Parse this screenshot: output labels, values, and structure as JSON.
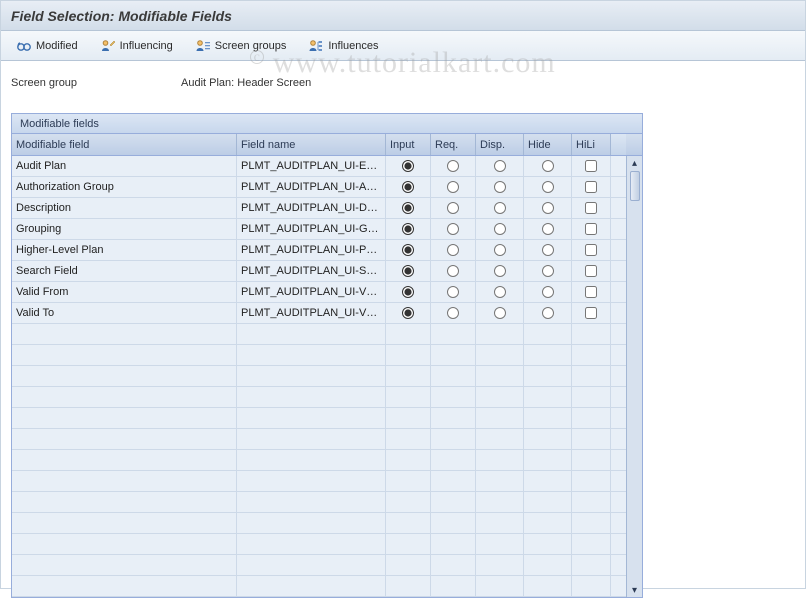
{
  "title": "Field Selection: Modifiable Fields",
  "toolbar": {
    "modified": "Modified",
    "influencing": "Influencing",
    "screen_groups": "Screen groups",
    "influences": "Influences"
  },
  "form": {
    "screen_group_label": "Screen group",
    "screen_group_value": "Audit Plan: Header Screen"
  },
  "table": {
    "title": "Modifiable fields",
    "columns": {
      "modifiable_field": "Modifiable field",
      "field_name": "Field name",
      "input": "Input",
      "req": "Req.",
      "disp": "Disp.",
      "hide": "Hide",
      "hili": "HiLi"
    },
    "rows": [
      {
        "label": "Audit Plan",
        "field": "PLMT_AUDITPLAN_UI-E…",
        "sel": "input"
      },
      {
        "label": "Authorization Group",
        "field": "PLMT_AUDITPLAN_UI-A…",
        "sel": "input"
      },
      {
        "label": "Description",
        "field": "PLMT_AUDITPLAN_UI-D…",
        "sel": "input"
      },
      {
        "label": "Grouping",
        "field": "PLMT_AUDITPLAN_UI-G…",
        "sel": "input"
      },
      {
        "label": "Higher-Level Plan",
        "field": "PLMT_AUDITPLAN_UI-P…",
        "sel": "input"
      },
      {
        "label": "Search Field",
        "field": "PLMT_AUDITPLAN_UI-S…",
        "sel": "input"
      },
      {
        "label": "Valid From",
        "field": "PLMT_AUDITPLAN_UI-V…",
        "sel": "input"
      },
      {
        "label": "Valid To",
        "field": "PLMT_AUDITPLAN_UI-V…",
        "sel": "input"
      }
    ],
    "empty_rows": 13
  },
  "watermark": "www.tutorialkart.com"
}
